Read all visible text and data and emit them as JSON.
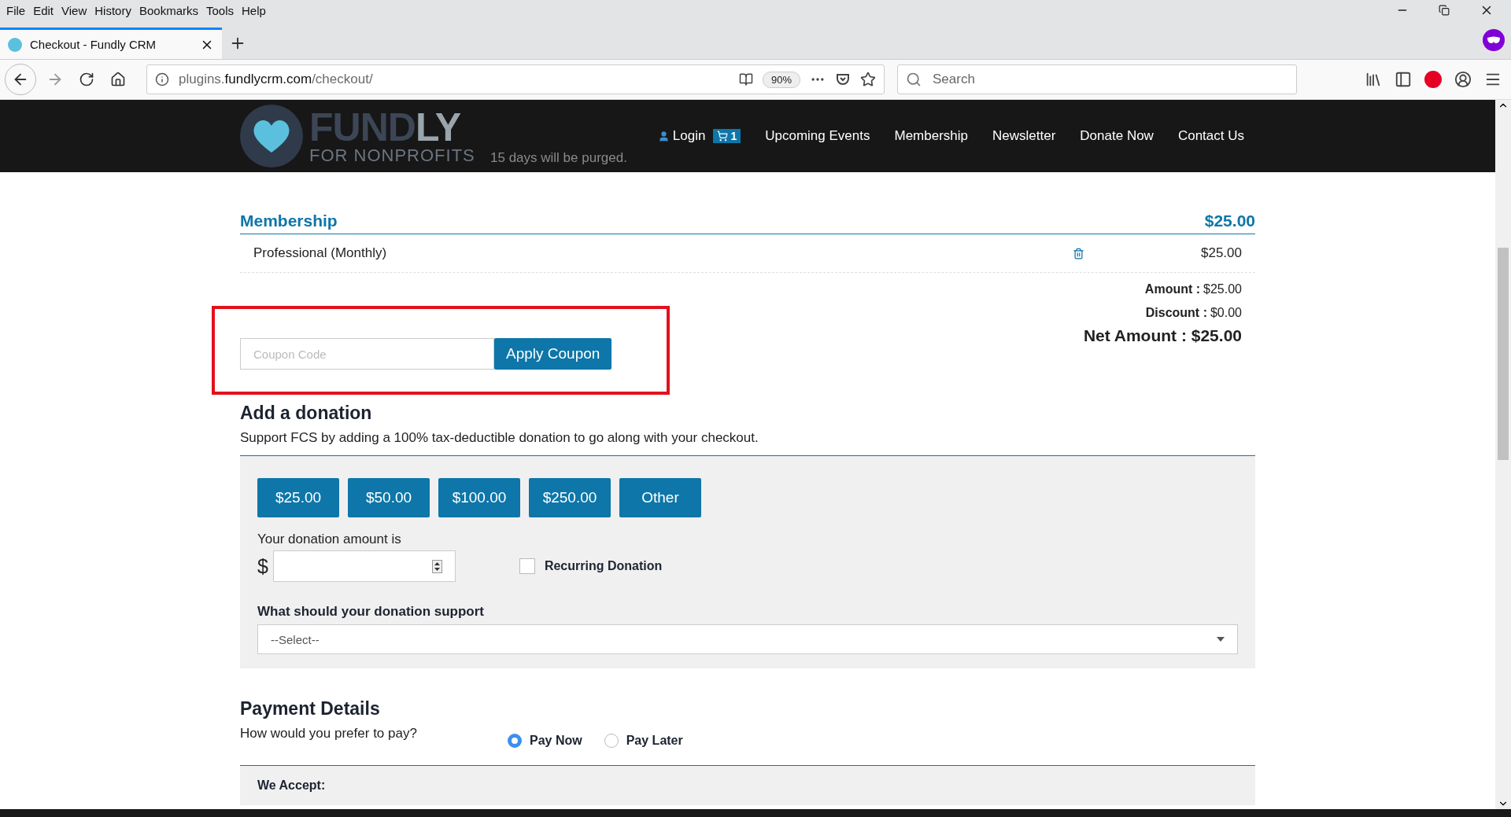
{
  "menu": [
    "File",
    "Edit",
    "View",
    "History",
    "Bookmarks",
    "Tools",
    "Help"
  ],
  "tab": {
    "title": "Checkout - Fundly CRM"
  },
  "url": {
    "prefix": "plugins.",
    "domain": "fundlycrm.com",
    "path": "/checkout/"
  },
  "zoom": "90%",
  "search": {
    "placeholder": "Search"
  },
  "header": {
    "logo_a": "FUND",
    "logo_b": "LY",
    "logo_sub": "FOR NONPROFITS",
    "login": "Login",
    "cart_count": "1",
    "nav": [
      "Upcoming Events",
      "Membership",
      "Newsletter",
      "Donate Now",
      "Contact Us"
    ]
  },
  "notice": "15 days will be purged.",
  "membership": {
    "title": "Membership",
    "total": "$25.00",
    "items": [
      {
        "name": "Professional (Monthly)",
        "price": "$25.00"
      }
    ]
  },
  "totals": [
    {
      "label": "Amount :",
      "value": "$25.00"
    },
    {
      "label": "Discount :",
      "value": "$0.00"
    }
  ],
  "net": {
    "label": "Net Amount :",
    "value": "$25.00"
  },
  "coupon": {
    "placeholder": "Coupon Code",
    "button": "Apply Coupon"
  },
  "donation": {
    "title": "Add a donation",
    "subtitle": "Support FCS by adding a 100% tax-deductible donation to go along with your checkout.",
    "presets": [
      "$25.00",
      "$50.00",
      "$100.00",
      "$250.00",
      "Other"
    ],
    "amount_label": "Your donation amount is",
    "currency": "$",
    "recurring": {
      "label": "Recurring Donation",
      "checked": false
    },
    "support_label": "What should your donation support",
    "select_placeholder": "--Select--"
  },
  "payment": {
    "title": "Payment Details",
    "question": "How would you prefer to pay?",
    "options": [
      {
        "label": "Pay Now",
        "selected": true
      },
      {
        "label": "Pay Later",
        "selected": false
      }
    ],
    "accept_label": "We Accept:"
  }
}
